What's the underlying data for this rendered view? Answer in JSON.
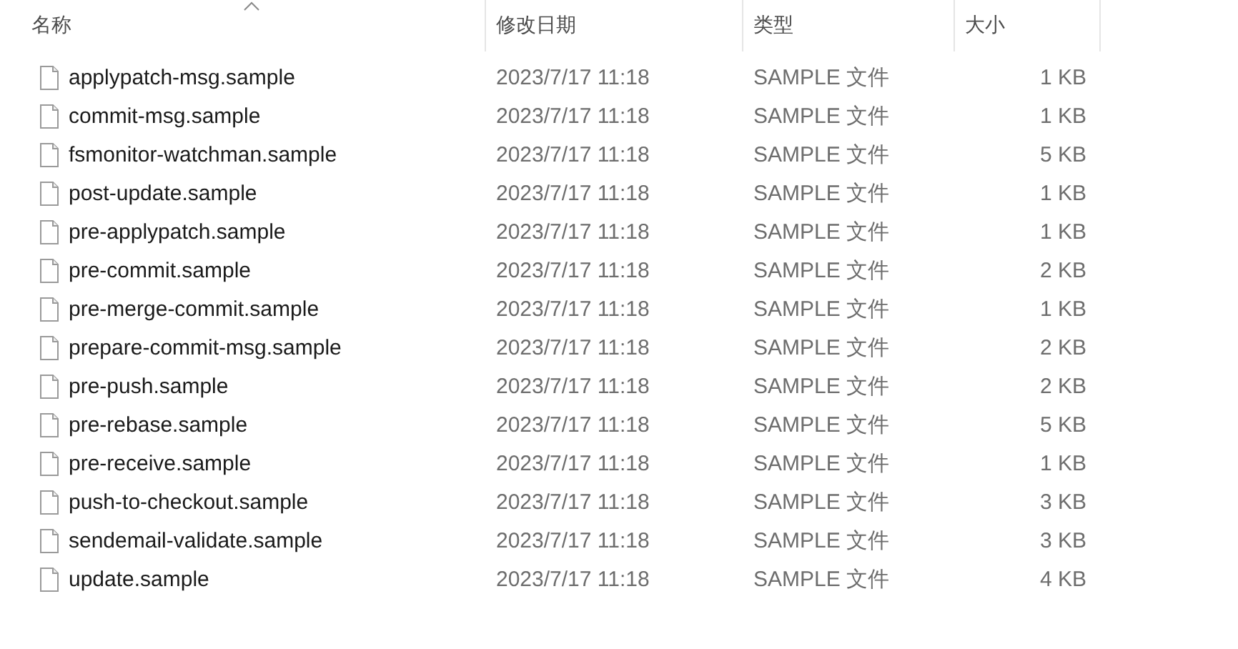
{
  "columns": [
    "名称",
    "修改日期",
    "类型",
    "大小"
  ],
  "rows": [
    {
      "name": "applypatch-msg.sample",
      "modified": "2023/7/17 11:18",
      "type": "SAMPLE 文件",
      "size": "1 KB"
    },
    {
      "name": "commit-msg.sample",
      "modified": "2023/7/17 11:18",
      "type": "SAMPLE 文件",
      "size": "1 KB"
    },
    {
      "name": "fsmonitor-watchman.sample",
      "modified": "2023/7/17 11:18",
      "type": "SAMPLE 文件",
      "size": "5 KB"
    },
    {
      "name": "post-update.sample",
      "modified": "2023/7/17 11:18",
      "type": "SAMPLE 文件",
      "size": "1 KB"
    },
    {
      "name": "pre-applypatch.sample",
      "modified": "2023/7/17 11:18",
      "type": "SAMPLE 文件",
      "size": "1 KB"
    },
    {
      "name": "pre-commit.sample",
      "modified": "2023/7/17 11:18",
      "type": "SAMPLE 文件",
      "size": "2 KB"
    },
    {
      "name": "pre-merge-commit.sample",
      "modified": "2023/7/17 11:18",
      "type": "SAMPLE 文件",
      "size": "1 KB"
    },
    {
      "name": "prepare-commit-msg.sample",
      "modified": "2023/7/17 11:18",
      "type": "SAMPLE 文件",
      "size": "2 KB"
    },
    {
      "name": "pre-push.sample",
      "modified": "2023/7/17 11:18",
      "type": "SAMPLE 文件",
      "size": "2 KB"
    },
    {
      "name": "pre-rebase.sample",
      "modified": "2023/7/17 11:18",
      "type": "SAMPLE 文件",
      "size": "5 KB"
    },
    {
      "name": "pre-receive.sample",
      "modified": "2023/7/17 11:18",
      "type": "SAMPLE 文件",
      "size": "1 KB"
    },
    {
      "name": "push-to-checkout.sample",
      "modified": "2023/7/17 11:18",
      "type": "SAMPLE 文件",
      "size": "3 KB"
    },
    {
      "name": "sendemail-validate.sample",
      "modified": "2023/7/17 11:18",
      "type": "SAMPLE 文件",
      "size": "3 KB"
    },
    {
      "name": "update.sample",
      "modified": "2023/7/17 11:18",
      "type": "SAMPLE 文件",
      "size": "4 KB"
    }
  ]
}
